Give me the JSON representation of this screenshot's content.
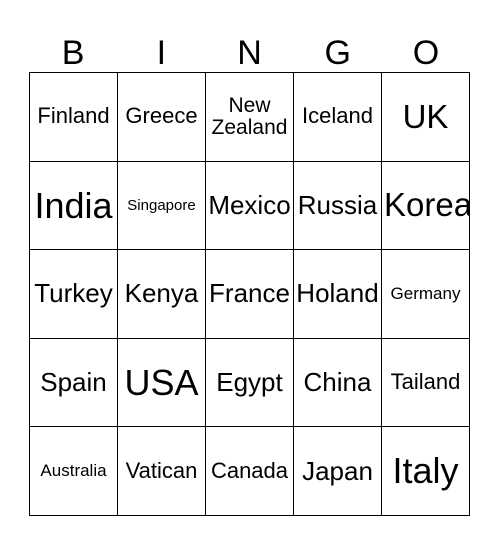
{
  "card": {
    "title": "BINGO",
    "headers": [
      "B",
      "I",
      "N",
      "G",
      "O"
    ],
    "rows": [
      [
        {
          "label": "Finland",
          "size": "sm"
        },
        {
          "label": "Greece",
          "size": "sm"
        },
        {
          "label": "New Zealand",
          "size": "wrap"
        },
        {
          "label": "Iceland",
          "size": "sm"
        },
        {
          "label": "UK",
          "size": "lg"
        }
      ],
      [
        {
          "label": "India",
          "size": "xl"
        },
        {
          "label": "Singapore",
          "size": "xxs"
        },
        {
          "label": "Mexico",
          "size": "md"
        },
        {
          "label": "Russia",
          "size": "md"
        },
        {
          "label": "Korea",
          "size": "lg"
        }
      ],
      [
        {
          "label": "Turkey",
          "size": "md"
        },
        {
          "label": "Kenya",
          "size": "md"
        },
        {
          "label": "France",
          "size": "md"
        },
        {
          "label": "Holand",
          "size": "md"
        },
        {
          "label": "Germany",
          "size": "xs"
        }
      ],
      [
        {
          "label": "Spain",
          "size": "md"
        },
        {
          "label": "USA",
          "size": "xl"
        },
        {
          "label": "Egypt",
          "size": "md"
        },
        {
          "label": "China",
          "size": "md"
        },
        {
          "label": "Tailand",
          "size": "sm"
        }
      ],
      [
        {
          "label": "Australia",
          "size": "xs"
        },
        {
          "label": "Vatican",
          "size": "sm"
        },
        {
          "label": "Canada",
          "size": "sm"
        },
        {
          "label": "Japan",
          "size": "md"
        },
        {
          "label": "Italy",
          "size": "xl"
        }
      ]
    ]
  },
  "colors": {
    "grid_line": "#000000",
    "text": "#000000",
    "background": "#ffffff"
  }
}
